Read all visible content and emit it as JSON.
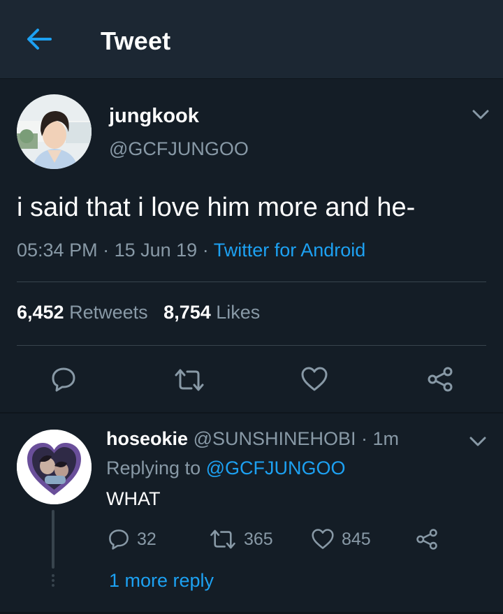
{
  "header": {
    "title": "Tweet"
  },
  "tweet": {
    "display_name": "jungkook",
    "handle": "@GCFJUNGOO",
    "text": "i said that i love him more and he-",
    "time": "05:34 PM",
    "sep1": " · ",
    "date": "15 Jun 19",
    "sep2": " · ",
    "source": "Twitter for Android",
    "retweets_count": "6,452",
    "retweets_label": "Retweets",
    "likes_count": "8,754",
    "likes_label": "Likes"
  },
  "reply": {
    "display_name": "hoseokie",
    "handle_time": "@SUNSHINEHOBI · 1m",
    "replying_prefix": "Replying to ",
    "replying_to": "@GCFJUNGOO",
    "text": "WHAT",
    "reply_count": "32",
    "retweet_count": "365",
    "like_count": "845",
    "more_replies": "1 more reply"
  },
  "colors": {
    "background": "#141d26",
    "header_bg": "#1c2733",
    "accent": "#1da1f2",
    "muted_text": "#8899a6",
    "divider": "#38444d"
  },
  "icons": [
    "back-arrow-icon",
    "chevron-down-icon",
    "reply-icon",
    "retweet-icon",
    "heart-icon",
    "share-icon"
  ]
}
